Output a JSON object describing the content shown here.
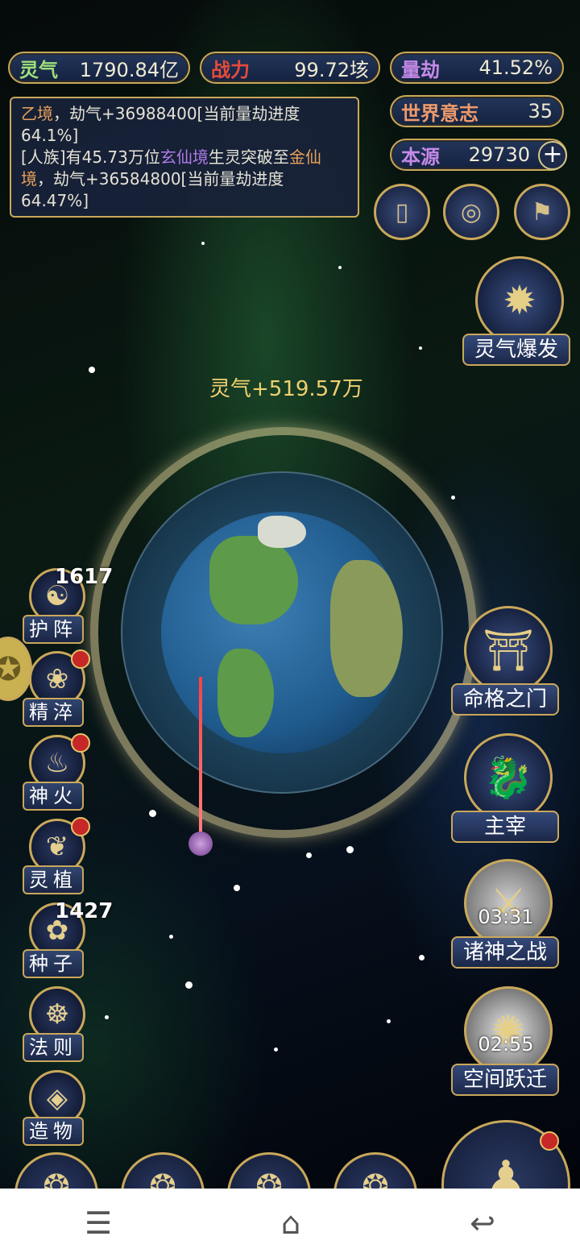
{
  "resources": {
    "lingqi": {
      "label": "灵气",
      "value": "1790.84亿"
    },
    "zhanli": {
      "label": "战力",
      "value": "99.72垓"
    },
    "liangjie": {
      "label": "量劫",
      "value": "41.52%"
    },
    "shijie": {
      "label": "世界意志",
      "value": "35"
    },
    "benyuan": {
      "label": "本源",
      "value": "29730"
    }
  },
  "log": {
    "line1_a": "乙境",
    "line1_b": "，劫气+36988400[当前量劫进度64.1%]",
    "line2_a": "[人族]有45.73万位",
    "line2_b": "玄仙境",
    "line2_c": "生灵突破至",
    "line2_d": "金仙境",
    "line2_e": "，劫气+36584800[当前量劫进度64.47%]"
  },
  "gain_text": "灵气+519.57万",
  "burst_label": "灵气爆发",
  "left_buttons": [
    {
      "label": "护阵",
      "count": "1617"
    },
    {
      "label": "精淬"
    },
    {
      "label": "神火"
    },
    {
      "label": "灵植"
    },
    {
      "label": "种子",
      "count": "1427"
    },
    {
      "label": "法则"
    },
    {
      "label": "造物"
    }
  ],
  "right_buttons": [
    {
      "label": "命格之门"
    },
    {
      "label": "主宰"
    },
    {
      "label": "诸神之战",
      "timer": "03:31"
    },
    {
      "label": "空间跃迁",
      "timer": "02:55"
    }
  ],
  "icons": {
    "plus": "+",
    "nav_menu": "☰",
    "nav_home": "⌂",
    "nav_back": "↩"
  }
}
